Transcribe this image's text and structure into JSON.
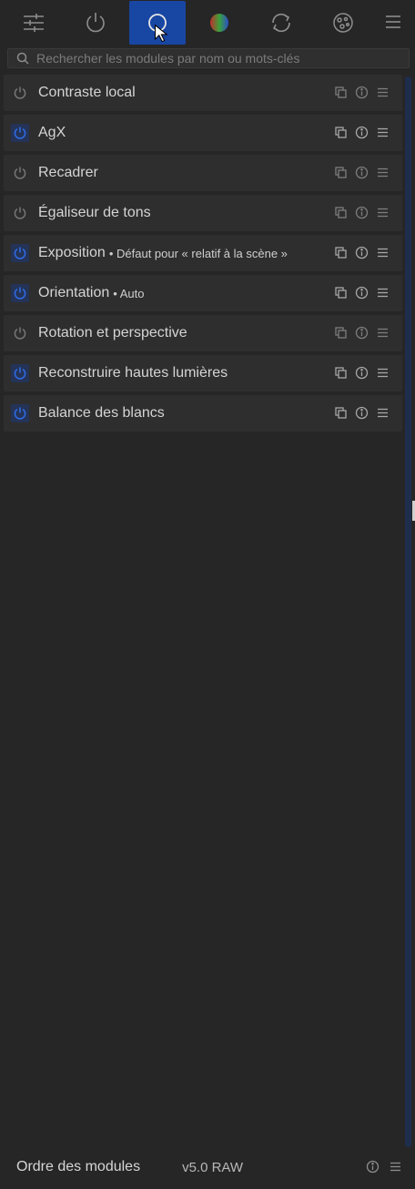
{
  "tabs": [
    {
      "name": "sliders-icon",
      "active": false
    },
    {
      "name": "power-icon",
      "active": false
    },
    {
      "name": "circle-icon",
      "active": true
    },
    {
      "name": "color-wheel-icon",
      "active": false
    },
    {
      "name": "refresh-icon",
      "active": false
    },
    {
      "name": "effects-icon",
      "active": false
    }
  ],
  "search": {
    "placeholder": "Rechercher les modules par nom ou mots-clés"
  },
  "modules": [
    {
      "name": "Contraste local",
      "subtitle": "",
      "enabled": false
    },
    {
      "name": "AgX",
      "subtitle": "",
      "enabled": true
    },
    {
      "name": "Recadrer",
      "subtitle": "",
      "enabled": false
    },
    {
      "name": "Égaliseur de tons",
      "subtitle": "",
      "enabled": false
    },
    {
      "name": "Exposition",
      "subtitle": "Défaut pour « relatif à la scène »",
      "enabled": true
    },
    {
      "name": "Orientation",
      "subtitle": "Auto",
      "enabled": true
    },
    {
      "name": "Rotation et perspective",
      "subtitle": "",
      "enabled": false
    },
    {
      "name": "Reconstruire hautes lumières",
      "subtitle": "",
      "enabled": true
    },
    {
      "name": "Balance des blancs",
      "subtitle": "",
      "enabled": true
    }
  ],
  "footer": {
    "title": "Ordre des modules",
    "version": "v5.0 RAW"
  },
  "colors": {
    "accent": "#1846a3",
    "power_on": "#2f6ee8"
  }
}
